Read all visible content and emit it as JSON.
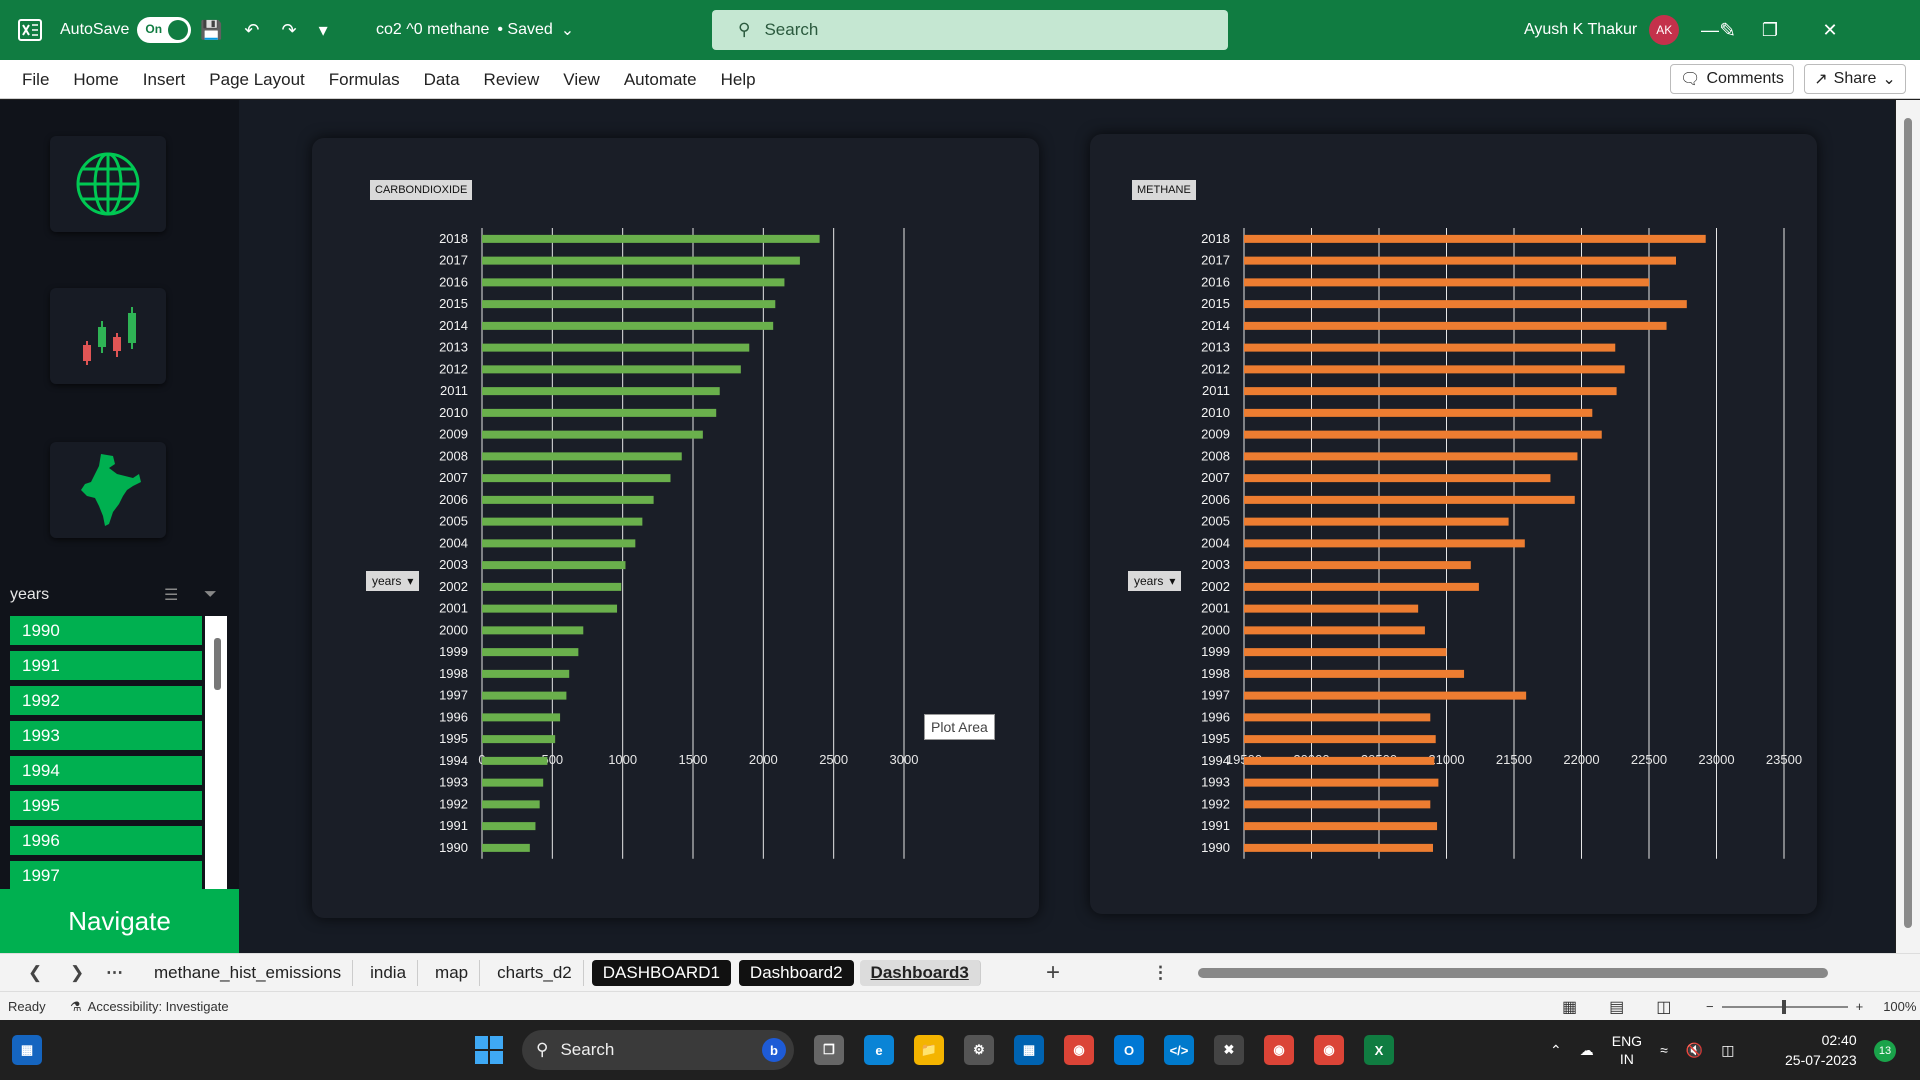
{
  "titlebar": {
    "autosave_label": "AutoSave",
    "autosave_state": "On",
    "doc_name": "co2 ^0 methane",
    "save_status": "• Saved",
    "search_placeholder": "Search",
    "user_name": "Ayush K Thakur",
    "user_initials": "AK"
  },
  "ribbon": {
    "tabs": [
      "File",
      "Home",
      "Insert",
      "Page Layout",
      "Formulas",
      "Data",
      "Review",
      "View",
      "Automate",
      "Help"
    ],
    "comments_label": "Comments",
    "share_label": "Share"
  },
  "sidebar": {
    "nav_icons": [
      "globe-icon",
      "candlestick-chart-icon",
      "india-map-icon"
    ],
    "slicer_title": "years",
    "slicer_items": [
      "1990",
      "1991",
      "1992",
      "1993",
      "1994",
      "1995",
      "1996",
      "1997"
    ],
    "navigate_label": "Navigate"
  },
  "chart_data": [
    {
      "type": "bar",
      "title": "CARBONDIOXIDE",
      "field_button": "years",
      "categories": [
        "1990",
        "1991",
        "1992",
        "1993",
        "1994",
        "1995",
        "1996",
        "1997",
        "1998",
        "1999",
        "2000",
        "2001",
        "2002",
        "2003",
        "2004",
        "2005",
        "2006",
        "2007",
        "2008",
        "2009",
        "2010",
        "2011",
        "2012",
        "2013",
        "2014",
        "2015",
        "2016",
        "2017",
        "2018"
      ],
      "values": [
        340,
        380,
        410,
        435,
        465,
        520,
        555,
        600,
        620,
        685,
        720,
        960,
        990,
        1020,
        1090,
        1140,
        1220,
        1340,
        1420,
        1570,
        1665,
        1690,
        1840,
        1900,
        2070,
        2085,
        2150,
        2260,
        2400
      ],
      "xlim": [
        0,
        3000
      ],
      "xticks": [
        0,
        500,
        1000,
        1500,
        2000,
        2500,
        3000
      ],
      "color": "#6ab04c",
      "grid": true
    },
    {
      "type": "bar",
      "title": "METHANE",
      "field_button": "years",
      "categories": [
        "1990",
        "1991",
        "1992",
        "1993",
        "1994",
        "1995",
        "1996",
        "1997",
        "1998",
        "1999",
        "2000",
        "2001",
        "2002",
        "2003",
        "2004",
        "2005",
        "2006",
        "2007",
        "2008",
        "2009",
        "2010",
        "2011",
        "2012",
        "2013",
        "2014",
        "2015",
        "2016",
        "2017",
        "2018"
      ],
      "values": [
        20900,
        20930,
        20880,
        20940,
        20910,
        20920,
        20880,
        21590,
        21130,
        21000,
        20840,
        20790,
        21240,
        21180,
        21580,
        21460,
        21950,
        21770,
        21970,
        22150,
        22080,
        22260,
        22320,
        22250,
        22630,
        22780,
        22500,
        22700,
        22920
      ],
      "xlim": [
        19500,
        23500
      ],
      "xticks": [
        19500,
        20000,
        20500,
        21000,
        21500,
        22000,
        22500,
        23000,
        23500
      ],
      "color": "#ed7d31",
      "grid": true
    }
  ],
  "tooltip": "Plot Area",
  "sheet_tabs": [
    {
      "label": "methane_hist_emissions",
      "style": "normal"
    },
    {
      "label": "india",
      "style": "normal"
    },
    {
      "label": "map",
      "style": "normal"
    },
    {
      "label": "charts_d2",
      "style": "normal"
    },
    {
      "label": "DASHBOARD1",
      "style": "dark"
    },
    {
      "label": "Dashboard2",
      "style": "dark"
    },
    {
      "label": "Dashboard3",
      "style": "active"
    }
  ],
  "status": {
    "ready": "Ready",
    "accessibility": "Accessibility: Investigate",
    "zoom": "100%"
  },
  "taskbar": {
    "search_placeholder": "Search",
    "lang_top": "ENG",
    "lang_bottom": "IN",
    "time": "02:40",
    "date": "25-07-2023",
    "notification_count": "13"
  }
}
